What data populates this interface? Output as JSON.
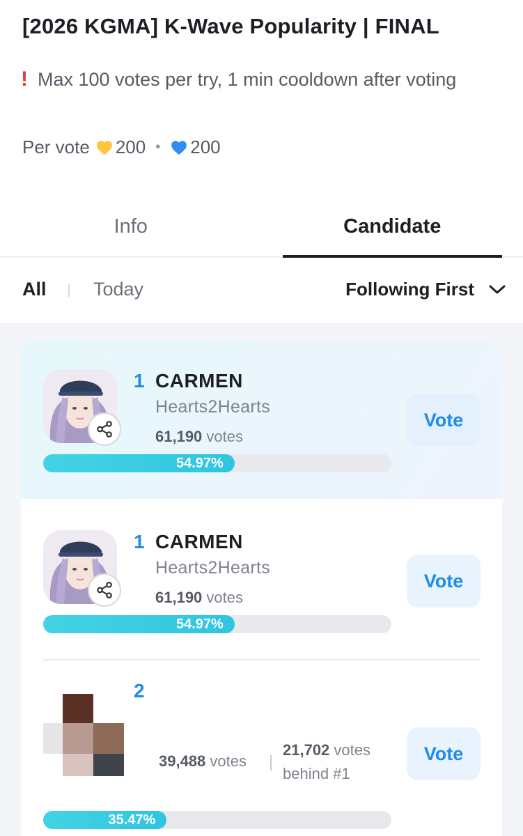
{
  "title": "[2026 KGMA] K-Wave Popularity | FINAL",
  "notice": {
    "icon": "exclamation-icon",
    "text": "Max 100 votes per try, 1 min cooldown after voting"
  },
  "per_vote": {
    "label": "Per vote",
    "gold_amount": "200",
    "blue_amount": "200",
    "gold_color": "#ffc53d",
    "blue_color": "#2f8cf0",
    "separator": "•"
  },
  "tabs": [
    {
      "label": "Info",
      "active": false
    },
    {
      "label": "Candidate",
      "active": true
    }
  ],
  "filters": {
    "all": "All",
    "today": "Today",
    "sort": "Following First"
  },
  "candidates": [
    {
      "rank": "1",
      "name": "CARMEN",
      "group": "Hearts2Hearts",
      "votes": "61,190",
      "votes_unit": "votes",
      "percent_label": "54.97%",
      "percent": 54.97,
      "vote_label": "Vote",
      "highlighted": true
    },
    {
      "rank": "1",
      "name": "CARMEN",
      "group": "Hearts2Hearts",
      "votes": "61,190",
      "votes_unit": "votes",
      "percent_label": "54.97%",
      "percent": 54.97,
      "vote_label": "Vote",
      "highlighted": false
    },
    {
      "rank": "2",
      "votes": "39,488",
      "votes_unit": "votes",
      "behind_votes": "21,702",
      "behind_unit": "votes",
      "behind_text": "behind #1",
      "percent_label": "35.47%",
      "percent": 35.47,
      "vote_label": "Vote",
      "highlighted": false
    }
  ],
  "colors": {
    "accent": "#1e8ce8",
    "progress": "#2fc5df",
    "vote_button_bg": "#e8f3fd"
  }
}
